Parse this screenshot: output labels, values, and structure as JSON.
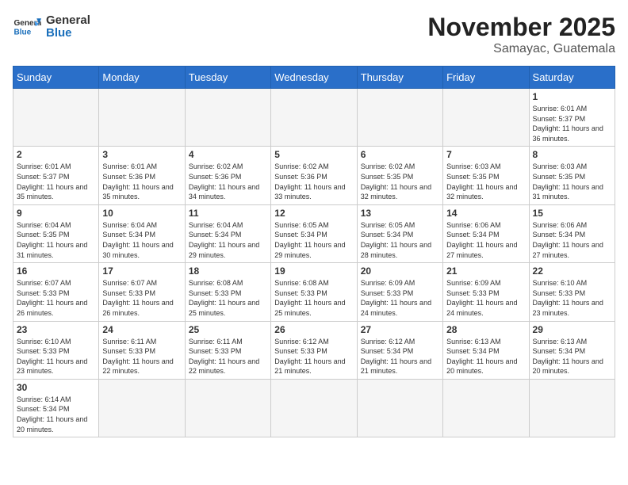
{
  "header": {
    "logo_general": "General",
    "logo_blue": "Blue",
    "month": "November 2025",
    "location": "Samayac, Guatemala"
  },
  "days_of_week": [
    "Sunday",
    "Monday",
    "Tuesday",
    "Wednesday",
    "Thursday",
    "Friday",
    "Saturday"
  ],
  "weeks": [
    [
      {
        "day": "",
        "info": ""
      },
      {
        "day": "",
        "info": ""
      },
      {
        "day": "",
        "info": ""
      },
      {
        "day": "",
        "info": ""
      },
      {
        "day": "",
        "info": ""
      },
      {
        "day": "",
        "info": ""
      },
      {
        "day": "1",
        "info": "Sunrise: 6:01 AM\nSunset: 5:37 PM\nDaylight: 11 hours and 36 minutes."
      }
    ],
    [
      {
        "day": "2",
        "info": "Sunrise: 6:01 AM\nSunset: 5:37 PM\nDaylight: 11 hours and 35 minutes."
      },
      {
        "day": "3",
        "info": "Sunrise: 6:01 AM\nSunset: 5:36 PM\nDaylight: 11 hours and 35 minutes."
      },
      {
        "day": "4",
        "info": "Sunrise: 6:02 AM\nSunset: 5:36 PM\nDaylight: 11 hours and 34 minutes."
      },
      {
        "day": "5",
        "info": "Sunrise: 6:02 AM\nSunset: 5:36 PM\nDaylight: 11 hours and 33 minutes."
      },
      {
        "day": "6",
        "info": "Sunrise: 6:02 AM\nSunset: 5:35 PM\nDaylight: 11 hours and 32 minutes."
      },
      {
        "day": "7",
        "info": "Sunrise: 6:03 AM\nSunset: 5:35 PM\nDaylight: 11 hours and 32 minutes."
      },
      {
        "day": "8",
        "info": "Sunrise: 6:03 AM\nSunset: 5:35 PM\nDaylight: 11 hours and 31 minutes."
      }
    ],
    [
      {
        "day": "9",
        "info": "Sunrise: 6:04 AM\nSunset: 5:35 PM\nDaylight: 11 hours and 31 minutes."
      },
      {
        "day": "10",
        "info": "Sunrise: 6:04 AM\nSunset: 5:34 PM\nDaylight: 11 hours and 30 minutes."
      },
      {
        "day": "11",
        "info": "Sunrise: 6:04 AM\nSunset: 5:34 PM\nDaylight: 11 hours and 29 minutes."
      },
      {
        "day": "12",
        "info": "Sunrise: 6:05 AM\nSunset: 5:34 PM\nDaylight: 11 hours and 29 minutes."
      },
      {
        "day": "13",
        "info": "Sunrise: 6:05 AM\nSunset: 5:34 PM\nDaylight: 11 hours and 28 minutes."
      },
      {
        "day": "14",
        "info": "Sunrise: 6:06 AM\nSunset: 5:34 PM\nDaylight: 11 hours and 27 minutes."
      },
      {
        "day": "15",
        "info": "Sunrise: 6:06 AM\nSunset: 5:34 PM\nDaylight: 11 hours and 27 minutes."
      }
    ],
    [
      {
        "day": "16",
        "info": "Sunrise: 6:07 AM\nSunset: 5:33 PM\nDaylight: 11 hours and 26 minutes."
      },
      {
        "day": "17",
        "info": "Sunrise: 6:07 AM\nSunset: 5:33 PM\nDaylight: 11 hours and 26 minutes."
      },
      {
        "day": "18",
        "info": "Sunrise: 6:08 AM\nSunset: 5:33 PM\nDaylight: 11 hours and 25 minutes."
      },
      {
        "day": "19",
        "info": "Sunrise: 6:08 AM\nSunset: 5:33 PM\nDaylight: 11 hours and 25 minutes."
      },
      {
        "day": "20",
        "info": "Sunrise: 6:09 AM\nSunset: 5:33 PM\nDaylight: 11 hours and 24 minutes."
      },
      {
        "day": "21",
        "info": "Sunrise: 6:09 AM\nSunset: 5:33 PM\nDaylight: 11 hours and 24 minutes."
      },
      {
        "day": "22",
        "info": "Sunrise: 6:10 AM\nSunset: 5:33 PM\nDaylight: 11 hours and 23 minutes."
      }
    ],
    [
      {
        "day": "23",
        "info": "Sunrise: 6:10 AM\nSunset: 5:33 PM\nDaylight: 11 hours and 23 minutes."
      },
      {
        "day": "24",
        "info": "Sunrise: 6:11 AM\nSunset: 5:33 PM\nDaylight: 11 hours and 22 minutes."
      },
      {
        "day": "25",
        "info": "Sunrise: 6:11 AM\nSunset: 5:33 PM\nDaylight: 11 hours and 22 minutes."
      },
      {
        "day": "26",
        "info": "Sunrise: 6:12 AM\nSunset: 5:33 PM\nDaylight: 11 hours and 21 minutes."
      },
      {
        "day": "27",
        "info": "Sunrise: 6:12 AM\nSunset: 5:34 PM\nDaylight: 11 hours and 21 minutes."
      },
      {
        "day": "28",
        "info": "Sunrise: 6:13 AM\nSunset: 5:34 PM\nDaylight: 11 hours and 20 minutes."
      },
      {
        "day": "29",
        "info": "Sunrise: 6:13 AM\nSunset: 5:34 PM\nDaylight: 11 hours and 20 minutes."
      }
    ],
    [
      {
        "day": "30",
        "info": "Sunrise: 6:14 AM\nSunset: 5:34 PM\nDaylight: 11 hours and 20 minutes."
      },
      {
        "day": "",
        "info": ""
      },
      {
        "day": "",
        "info": ""
      },
      {
        "day": "",
        "info": ""
      },
      {
        "day": "",
        "info": ""
      },
      {
        "day": "",
        "info": ""
      },
      {
        "day": "",
        "info": ""
      }
    ]
  ]
}
